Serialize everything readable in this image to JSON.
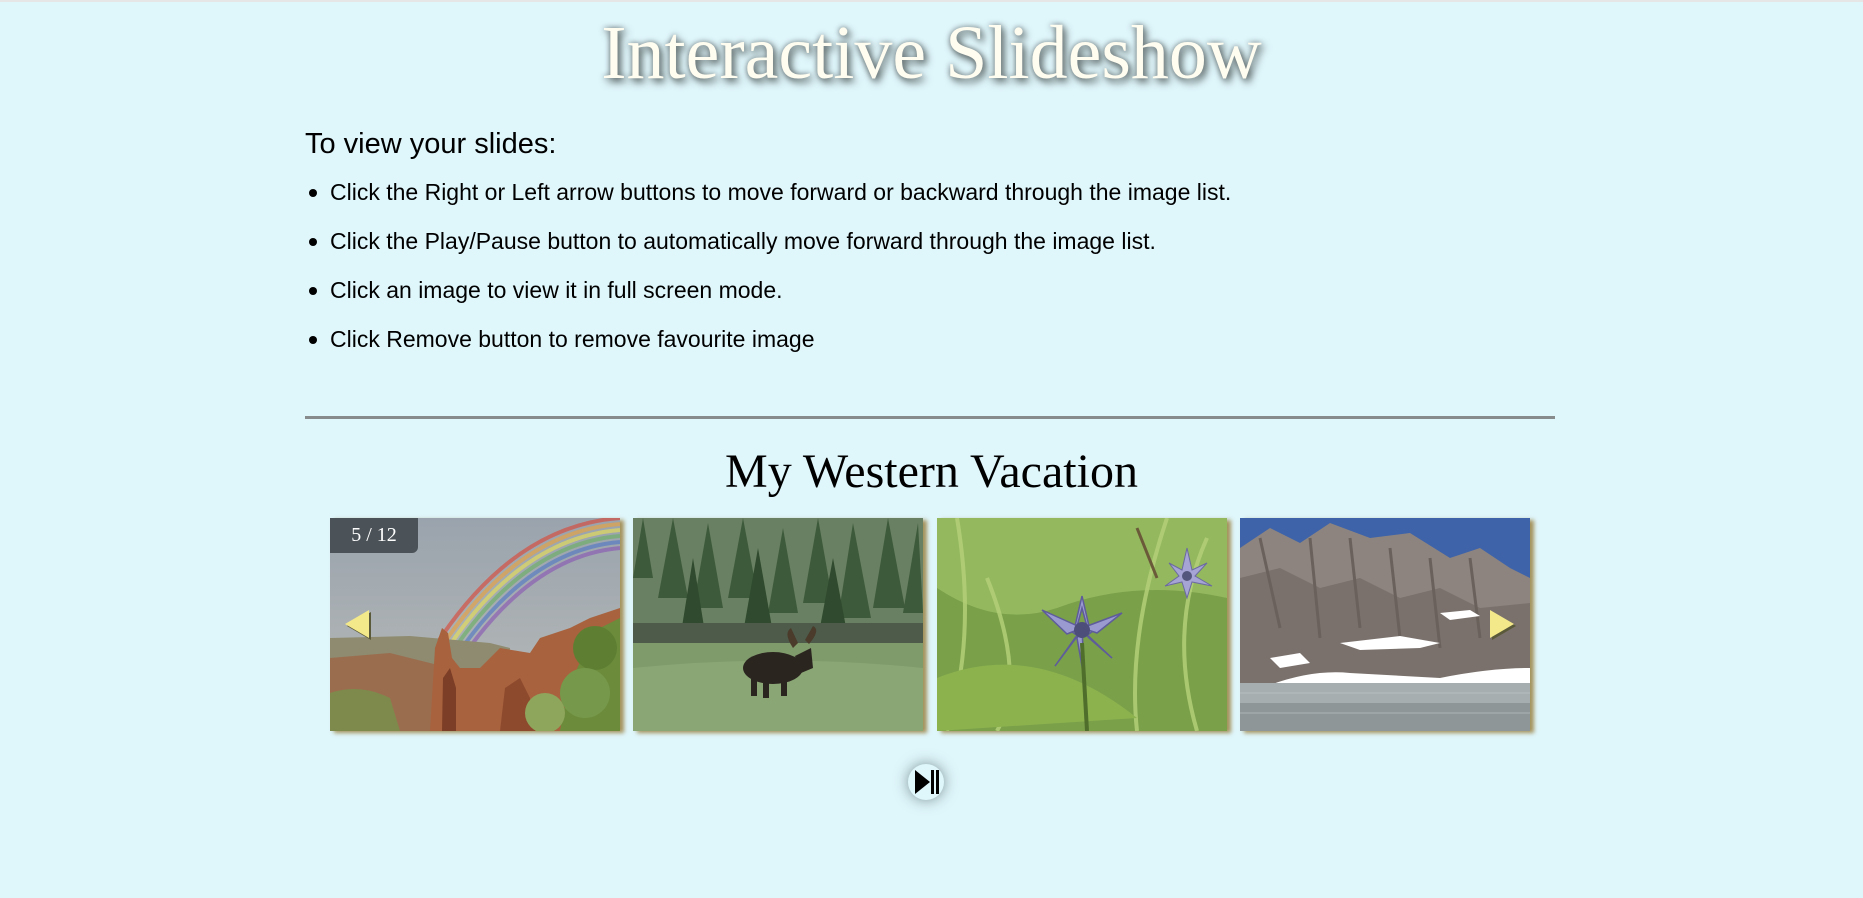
{
  "page": {
    "title": "Interactive Slideshow"
  },
  "instructions": {
    "heading": "To view your slides:",
    "items": [
      "Click the Right or Left arrow buttons to move forward or backward through the image list.",
      "Click the Play/Pause button to automatically move forward through the image list.",
      "Click an image to view it in full screen mode.",
      "Click Remove button to remove favourite image"
    ]
  },
  "slideshow": {
    "title": "My Western Vacation",
    "counter": "5 / 12",
    "current_index": 5,
    "total": 12,
    "slides": [
      {
        "subject": "rainbow over red rock canyon"
      },
      {
        "subject": "moose in forest meadow by lake"
      },
      {
        "subject": "purple star wildflower"
      },
      {
        "subject": "snowy mountain cirque with lake"
      }
    ],
    "controls": {
      "prev_icon": "left-arrow-icon",
      "next_icon": "right-arrow-icon",
      "play_pause_icon": "play-pause-icon"
    }
  },
  "colors": {
    "background": "#dff6fb",
    "arrow": "#f4e98a",
    "counter_bg": "#4b5358",
    "divider": "#878b8c"
  }
}
